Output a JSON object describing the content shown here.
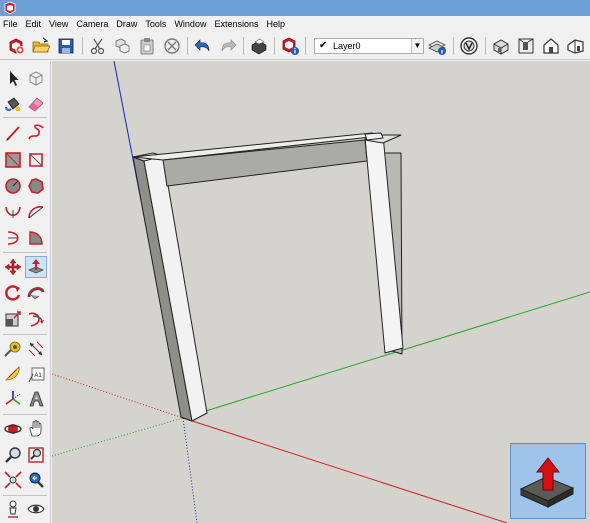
{
  "window": {
    "app_icon": "sketchup-logo-icon"
  },
  "menu": {
    "items": [
      "File",
      "Edit",
      "View",
      "Camera",
      "Draw",
      "Tools",
      "Window",
      "Extensions",
      "Help"
    ]
  },
  "toolbar": {
    "layer_selector": {
      "check": "✔",
      "value": "Layer0"
    },
    "icons": [
      "new-file-icon",
      "open-folder-icon",
      "save-icon",
      "cut-icon",
      "copy-icon",
      "paste-icon",
      "erase-icon",
      "undo-icon",
      "redo-icon",
      "print-icon",
      "model-info-icon",
      "layer-manager-icon",
      "styles-icon",
      "iso-view-icon",
      "top-view-icon",
      "front-view-icon",
      "right-view-icon"
    ]
  },
  "tool_palette": {
    "icons": [
      "select-icon",
      "make-component-icon",
      "paint-bucket-icon",
      "eraser-icon",
      "line-icon",
      "freehand-icon",
      "rectangle-icon",
      "rotated-rectangle-icon",
      "circle-icon",
      "polygon-icon",
      "arc-icon",
      "two-point-arc-icon",
      "three-point-arc-icon",
      "pie-icon",
      "move-icon",
      "push-pull-icon",
      "rotate-icon",
      "follow-me-icon",
      "scale-icon",
      "offset-icon",
      "tape-measure-icon",
      "dimension-icon",
      "protractor-icon",
      "text-icon",
      "axes-icon",
      "3d-text-icon",
      "orbit-icon",
      "pan-icon",
      "zoom-icon",
      "zoom-window-icon",
      "zoom-extents-icon",
      "zoom-previous-icon",
      "position-camera-icon",
      "look-around-icon"
    ],
    "active_tool": "push-pull-icon",
    "text_tool_label": "A1"
  },
  "viewport": {
    "background": "#d4d3ce",
    "axes": {
      "red": "#d02020",
      "green": "#2fa02f",
      "blue": "#2020c8"
    },
    "model": "frame-object"
  },
  "instructor": {
    "icon": "push-pull-instructor-icon",
    "background": "#9ec4ec"
  }
}
